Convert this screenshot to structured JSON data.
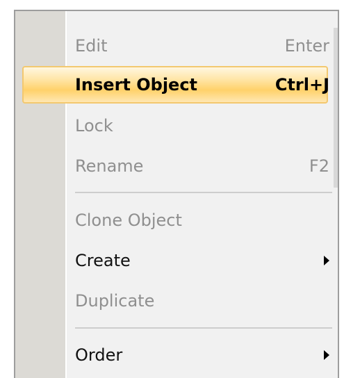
{
  "menu": {
    "items": [
      {
        "label": "Edit",
        "shortcut": "Enter",
        "state": "disabled"
      },
      {
        "label": "Insert Object",
        "shortcut": "Ctrl+J",
        "state": "highlighted"
      },
      {
        "label": "Lock",
        "shortcut": "",
        "state": "disabled"
      },
      {
        "label": "Rename",
        "shortcut": "F2",
        "state": "disabled"
      },
      {
        "label": "Clone Object",
        "shortcut": "",
        "state": "disabled"
      },
      {
        "label": "Create",
        "shortcut": "",
        "state": "enabled",
        "submenu": "chevron-right-icon"
      },
      {
        "label": "Duplicate",
        "shortcut": "",
        "state": "disabled"
      },
      {
        "label": "Order",
        "shortcut": "",
        "state": "enabled",
        "submenu": "chevron-right-icon"
      }
    ]
  },
  "colors": {
    "highlight_border": "#f3c86f",
    "highlight_fill": "#ffd16a",
    "disabled_text": "#8f8f8f",
    "gutter": "#dcdad5"
  }
}
